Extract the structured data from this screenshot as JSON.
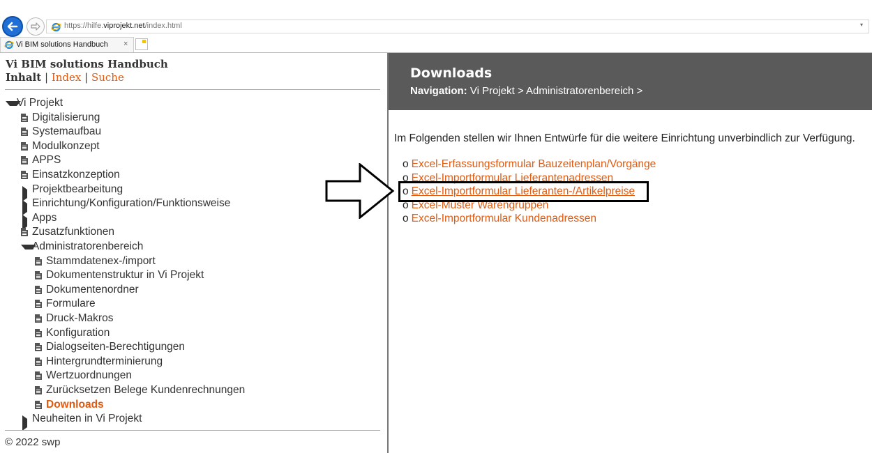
{
  "browser": {
    "url_host": "https://hilfe.",
    "url_domain": "viprojekt.net",
    "url_path": "/index.html",
    "tab_title": "Vi BIM solutions Handbuch",
    "tab_close": "×",
    "dropdown": "▾"
  },
  "left": {
    "title": "Vi BIM solutions Handbuch",
    "nav": [
      {
        "label": "Inhalt",
        "current": true
      },
      {
        "label": "Index"
      },
      {
        "label": "Suche"
      }
    ],
    "separator": "|",
    "tree": [
      {
        "label": "Vi Projekt",
        "icon": "expanded",
        "level": 0
      },
      {
        "label": "Digitalisierung",
        "icon": "page",
        "level": 1
      },
      {
        "label": "Systemaufbau",
        "icon": "page",
        "level": 1
      },
      {
        "label": "Modulkonzept",
        "icon": "page",
        "level": 1
      },
      {
        "label": "APPS",
        "icon": "page",
        "level": 1
      },
      {
        "label": "Einsatzkonzeption",
        "icon": "page",
        "level": 1
      },
      {
        "label": "Projektbearbeitung",
        "icon": "collapsed",
        "level": 1
      },
      {
        "label": "Einrichtung/Konfiguration/Funktionsweise",
        "icon": "collapsed",
        "level": 1
      },
      {
        "label": "Apps",
        "icon": "collapsed",
        "level": 1
      },
      {
        "label": "Zusatzfunktionen",
        "icon": "page",
        "level": 1
      },
      {
        "label": "Administratorenbereich",
        "icon": "expanded",
        "level": 1
      },
      {
        "label": "Stammdatenex-/import",
        "icon": "page",
        "level": 2
      },
      {
        "label": "Dokumentenstruktur in Vi Projekt",
        "icon": "page",
        "level": 2
      },
      {
        "label": "Dokumentenordner",
        "icon": "page",
        "level": 2
      },
      {
        "label": "Formulare",
        "icon": "page",
        "level": 2
      },
      {
        "label": "Druck-Makros",
        "icon": "page",
        "level": 2
      },
      {
        "label": "Konfiguration",
        "icon": "page",
        "level": 2
      },
      {
        "label": "Dialogseiten-Berechtigungen",
        "icon": "page",
        "level": 2
      },
      {
        "label": "Hintergrundterminierung",
        "icon": "page",
        "level": 2
      },
      {
        "label": "Wertzuordnungen",
        "icon": "page",
        "level": 2
      },
      {
        "label": "Zurücksetzen Belege Kundenrechnungen",
        "icon": "page",
        "level": 2
      },
      {
        "label": "Downloads",
        "icon": "page",
        "level": 2,
        "active": true
      },
      {
        "label": "Neuheiten in Vi Projekt",
        "icon": "collapsed",
        "level": 1
      }
    ],
    "copyright": "© 2022 swp"
  },
  "right": {
    "title": "Downloads",
    "nav_label": "Navigation:",
    "nav_path": "Vi Projekt > Administratorenbereich >",
    "intro": "Im Folgenden stellen wir Ihnen Entwürfe für die weitere Einrichtung unverbindlich zur Verfügung.",
    "bullet": "o",
    "downloads": [
      {
        "label": "Excel-Erfassungsformular Bauzeitenplan/Vorgänge"
      },
      {
        "label": "Excel-Importformular Lieferantenadressen"
      },
      {
        "label": "Excel-Importformular Lieferanten-/Artikelpreise",
        "highlighted": true
      },
      {
        "label": "Excel-Muster Warengruppen"
      },
      {
        "label": "Excel-Importformular Kundenadressen"
      }
    ]
  },
  "colors": {
    "link": "#e05a10",
    "header_bg": "#5a5a5a",
    "back_button": "#1f6fd6"
  }
}
